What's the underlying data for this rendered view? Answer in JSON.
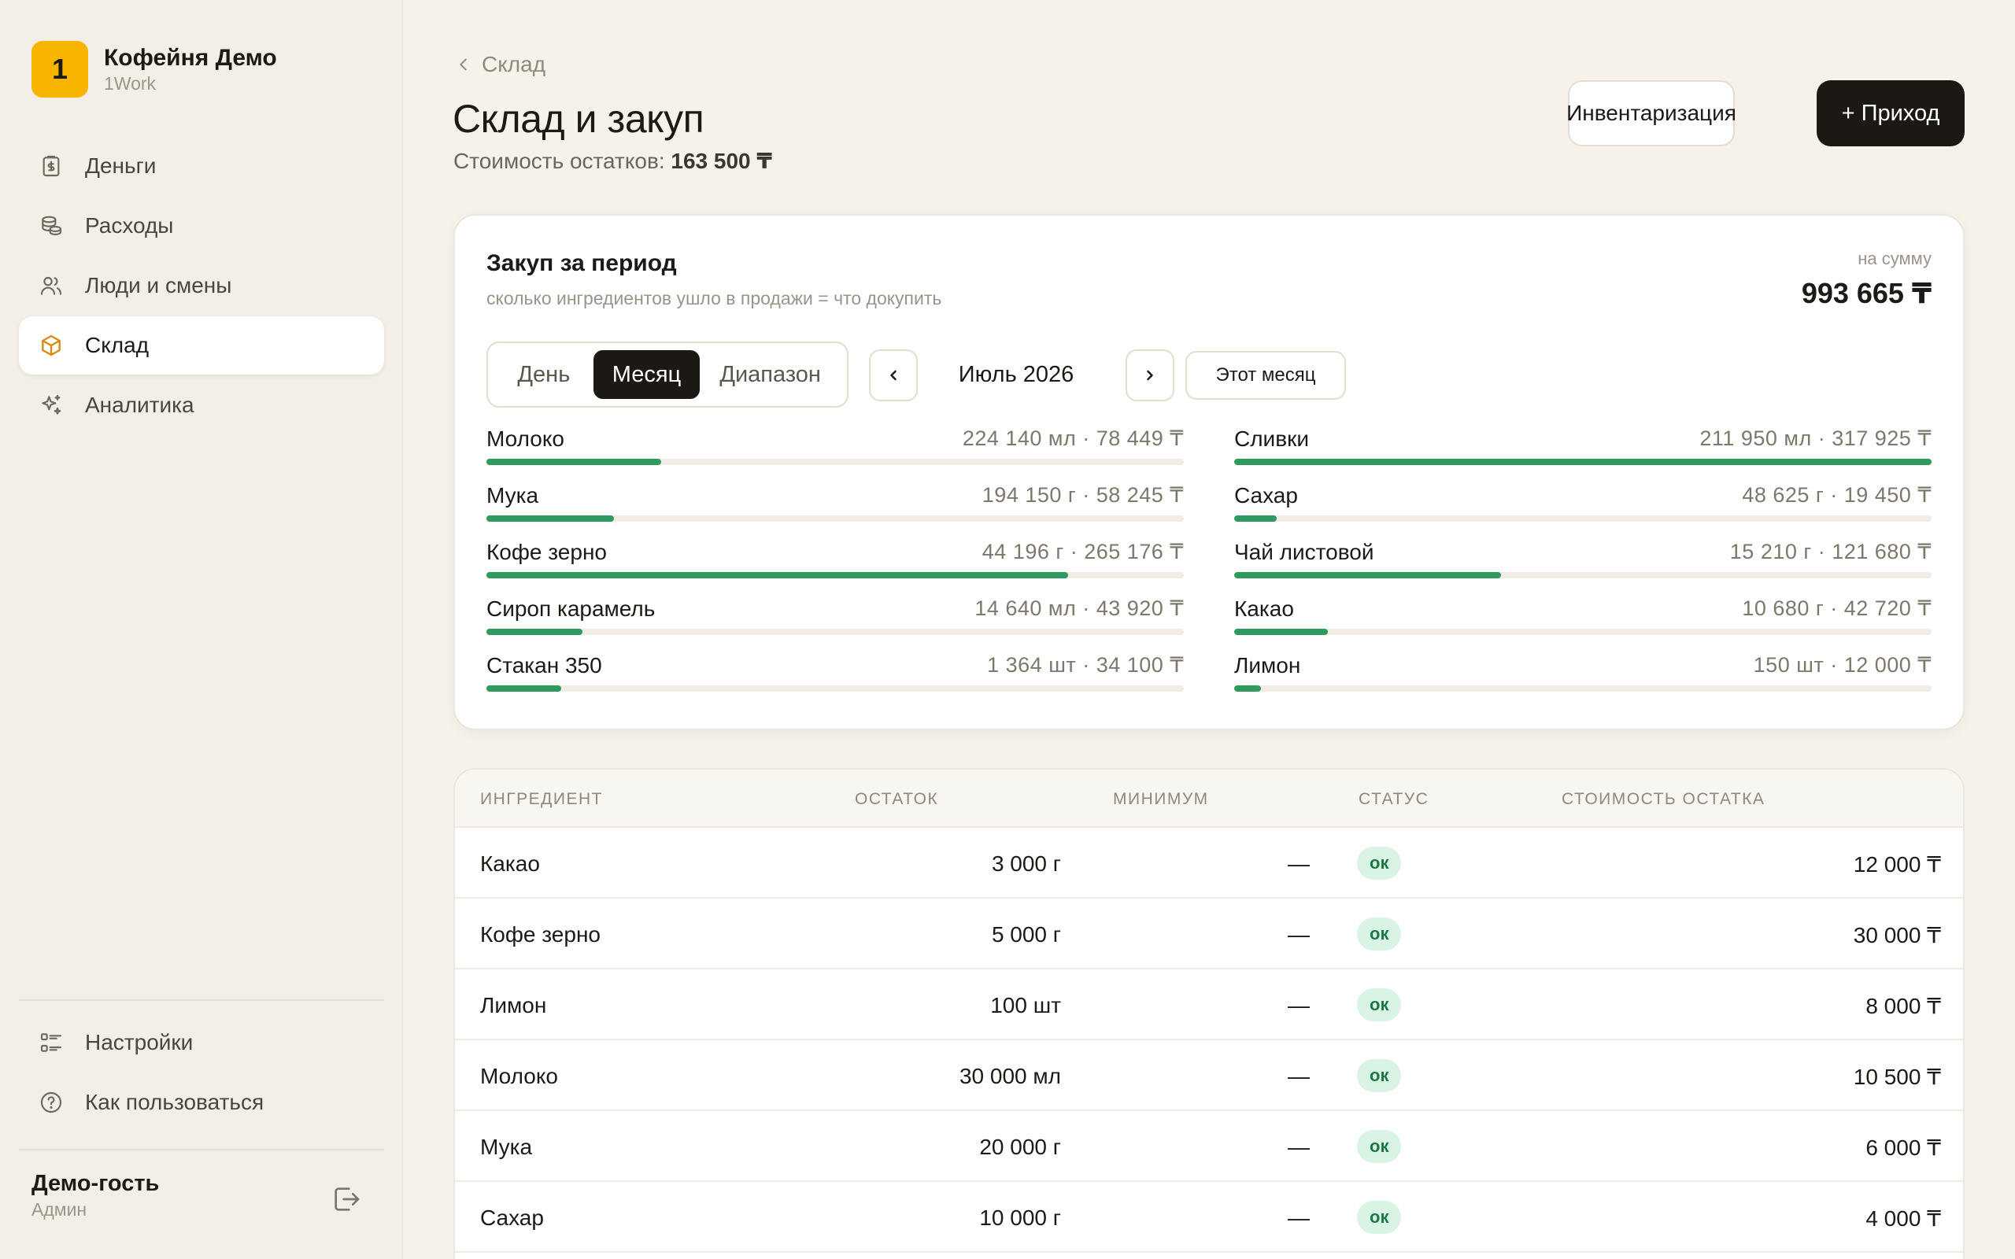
{
  "brand": {
    "logo_char": "1",
    "name": "Кофейня Демо",
    "sub": "1Work",
    "color": "#f7b500"
  },
  "nav": [
    {
      "label": "Деньги",
      "icon": "clipboard-money-icon"
    },
    {
      "label": "Расходы",
      "icon": "coins-icon"
    },
    {
      "label": "Люди и смены",
      "icon": "users-icon"
    },
    {
      "label": "Склад",
      "icon": "box-icon",
      "active": true
    },
    {
      "label": "Аналитика",
      "icon": "sparkles-icon"
    }
  ],
  "nav_bottom": [
    {
      "label": "Настройки",
      "icon": "list-settings-icon"
    },
    {
      "label": "Как пользоваться",
      "icon": "help-circle-icon"
    }
  ],
  "user": {
    "name": "Демо-гость",
    "role": "Админ"
  },
  "header": {
    "breadcrumb": "Склад",
    "title": "Склад и закуп",
    "sub_label": "Стоимость остатков:",
    "sub_value": "163 500 ₸",
    "btn_inventory": "Инвентаризация",
    "btn_income": "+ Приход"
  },
  "purchase": {
    "title": "Закуп за период",
    "subtitle": "сколько ингредиентов ушло в продажи = что докупить",
    "sum_label": "на сумму",
    "sum": "993 665 ₸",
    "segments": [
      "День",
      "Месяц",
      "Диапазон"
    ],
    "active_segment": "Месяц",
    "period": "Июль 2026",
    "this_month": "Этот месяц",
    "accent": "#2e9a5e",
    "left": [
      {
        "name": "Молоко",
        "value": "224 140 мл · 78 449 ₸",
        "level": 0.25
      },
      {
        "name": "Мука",
        "value": "194 150 г · 58 245 ₸",
        "level": 0.183
      },
      {
        "name": "Кофе зерно",
        "value": "44 196 г · 265 176 ₸",
        "level": 0.834
      },
      {
        "name": "Сироп карамель",
        "value": "14 640 мл · 43 920 ₸",
        "level": 0.138
      },
      {
        "name": "Стакан 350",
        "value": "1 364 шт · 34 100 ₸",
        "level": 0.107
      }
    ],
    "right": [
      {
        "name": "Сливки",
        "value": "211 950 мл · 317 925 ₸",
        "level": 1.0
      },
      {
        "name": "Сахар",
        "value": "48 625 г · 19 450 ₸",
        "level": 0.061
      },
      {
        "name": "Чай листовой",
        "value": "15 210 г · 121 680 ₸",
        "level": 0.383
      },
      {
        "name": "Какао",
        "value": "10 680 г · 42 720 ₸",
        "level": 0.134
      },
      {
        "name": "Лимон",
        "value": "150 шт · 12 000 ₸",
        "level": 0.038
      }
    ]
  },
  "table": {
    "headers": [
      "ИНГРЕДИЕНТ",
      "ОСТАТОК",
      "МИНИМУМ",
      "СТАТУС",
      "СТОИМОСТЬ ОСТАТКА"
    ],
    "rows": [
      {
        "name": "Какао",
        "stock": "3 000 г",
        "min": "—",
        "status": "ок",
        "cost": "12 000 ₸"
      },
      {
        "name": "Кофе зерно",
        "stock": "5 000 г",
        "min": "—",
        "status": "ок",
        "cost": "30 000 ₸"
      },
      {
        "name": "Лимон",
        "stock": "100 шт",
        "min": "—",
        "status": "ок",
        "cost": "8 000 ₸"
      },
      {
        "name": "Молоко",
        "stock": "30 000 мл",
        "min": "—",
        "status": "ок",
        "cost": "10 500 ₸"
      },
      {
        "name": "Мука",
        "stock": "20 000 г",
        "min": "—",
        "status": "ок",
        "cost": "6 000 ₸"
      },
      {
        "name": "Сахар",
        "stock": "10 000 г",
        "min": "—",
        "status": "ок",
        "cost": "4 000 ₸"
      }
    ]
  }
}
